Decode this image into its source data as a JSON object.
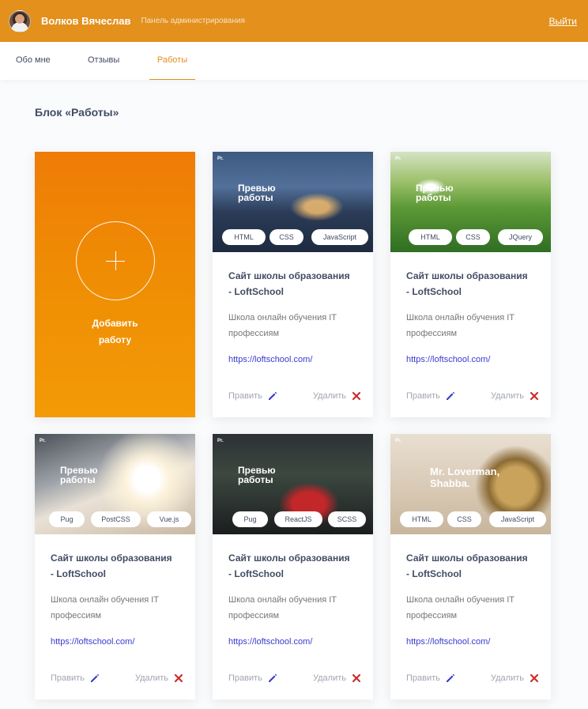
{
  "header": {
    "user_name": "Волков Вячеслав",
    "panel_title": "Панель администрирования",
    "logout": "Выйти",
    "accent_color": "#e3901c"
  },
  "tabs": [
    {
      "label": "Обо мне",
      "active": false
    },
    {
      "label": "Отзывы",
      "active": false
    },
    {
      "label": "Работы",
      "active": true
    }
  ],
  "section": {
    "title": "Блок «Работы»"
  },
  "add_card": {
    "label_line1": "Добавить",
    "label_line2": "работу"
  },
  "works": [
    {
      "preview_title_1": "Превью",
      "preview_title_2": "работы",
      "tags": [
        "HTML",
        "CSS",
        "JavaScript"
      ],
      "title_1": "Сайт школы образования",
      "title_2": "- LoftSchool",
      "desc_1": "Школа онлайн обучения IT",
      "desc_2": "профессиям",
      "link": "https://loftschool.com/",
      "edit": "Править",
      "delete": "Удалить"
    },
    {
      "preview_title_1": "Превью",
      "preview_title_2": "работы",
      "tags": [
        "HTML",
        "CSS",
        "JQuery"
      ],
      "title_1": "Сайт школы образования",
      "title_2": "- LoftSchool",
      "desc_1": "Школа онлайн обучения IT",
      "desc_2": "профессиям",
      "link": "https://loftschool.com/",
      "edit": "Править",
      "delete": "Удалить"
    },
    {
      "preview_title_1": "Превью",
      "preview_title_2": "работы",
      "tags": [
        "Pug",
        "PostCSS",
        "Vue.js"
      ],
      "title_1": "Сайт школы образования",
      "title_2": "- LoftSchool",
      "desc_1": "Школа онлайн обучения IT",
      "desc_2": "профессиям",
      "link": "https://loftschool.com/",
      "edit": "Править",
      "delete": "Удалить"
    },
    {
      "preview_title_1": "Превью",
      "preview_title_2": "работы",
      "tags": [
        "Pug",
        "ReactJS",
        "SCSS"
      ],
      "title_1": "Сайт школы образования",
      "title_2": "- LoftSchool",
      "desc_1": "Школа онлайн обучения IT",
      "desc_2": "профессиям",
      "link": "https://loftschool.com/",
      "edit": "Править",
      "delete": "Удалить"
    },
    {
      "preview_title_1": "Mr. Loverman,",
      "preview_title_2": "Shabba.",
      "tags": [
        "HTML",
        "CSS",
        "JavaScript"
      ],
      "title_1": "Сайт школы образования",
      "title_2": "- LoftSchool",
      "desc_1": "Школа онлайн обучения IT",
      "desc_2": "профессиям",
      "link": "https://loftschool.com/",
      "edit": "Править",
      "delete": "Удалить"
    }
  ],
  "icons": {
    "edit": "pencil-icon",
    "delete": "close-icon",
    "add": "plus-icon"
  },
  "colors": {
    "edit_icon": "#383bcf",
    "delete_icon": "#c92e2e",
    "link": "#383bcf"
  }
}
